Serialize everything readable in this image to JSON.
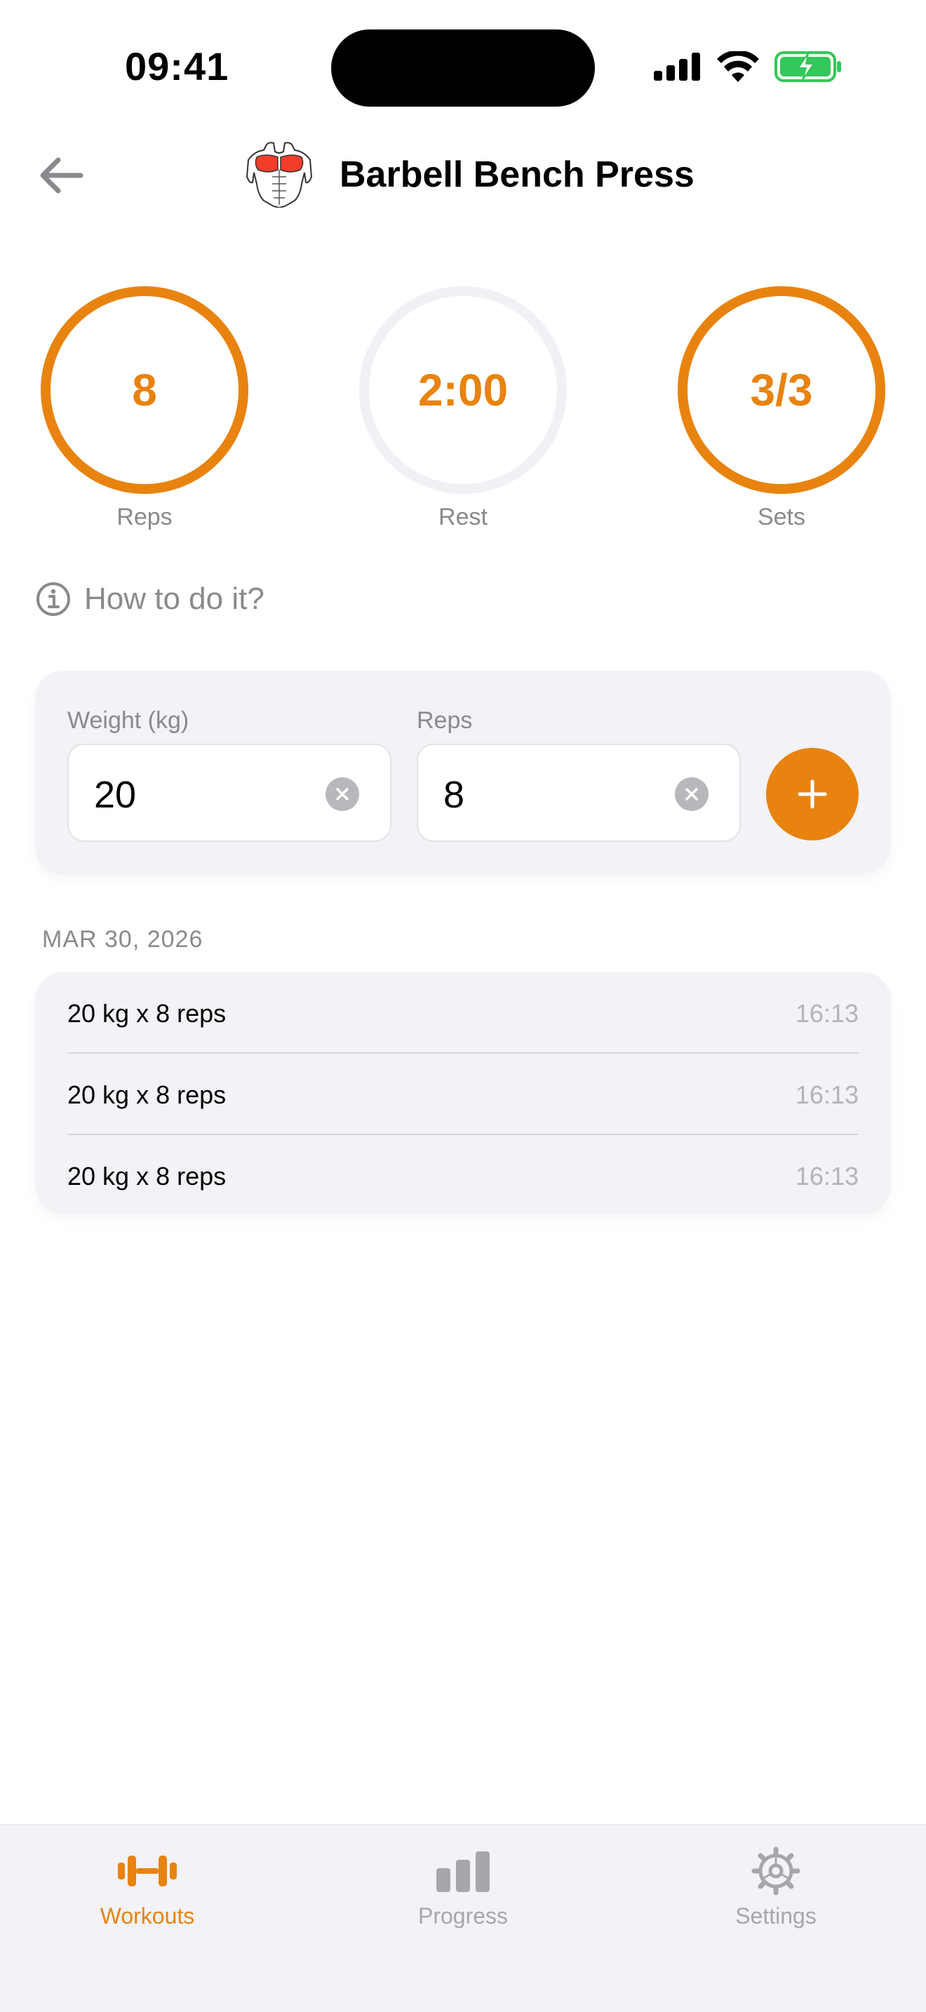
{
  "status_bar": {
    "time": "09:41"
  },
  "header": {
    "title": "Barbell Bench Press",
    "back_icon": "arrow-left-icon",
    "exercise_icon": "chest-muscle-icon"
  },
  "stats": [
    {
      "value": "8",
      "label": "Reps",
      "active": true
    },
    {
      "value": "2:00",
      "label": "Rest",
      "active": false
    },
    {
      "value": "3/3",
      "label": "Sets",
      "active": true
    }
  ],
  "how_to": {
    "label": "How to do it?",
    "icon": "info-icon"
  },
  "input": {
    "weight_label": "Weight (kg)",
    "weight_value": "20",
    "reps_label": "Reps",
    "reps_value": "8",
    "add_icon": "plus-icon"
  },
  "history": {
    "date": "MAR 30, 2026",
    "entries": [
      {
        "text": "20 kg x 8 reps",
        "time": "16:13"
      },
      {
        "text": "20 kg x 8 reps",
        "time": "16:13"
      },
      {
        "text": "20 kg x 8 reps",
        "time": "16:13"
      }
    ]
  },
  "tab_bar": {
    "tabs": [
      {
        "label": "Workouts",
        "icon": "dumbbell-icon",
        "active": true
      },
      {
        "label": "Progress",
        "icon": "bar-chart-icon",
        "active": false
      },
      {
        "label": "Settings",
        "icon": "gear-icon",
        "active": false
      }
    ]
  },
  "colors": {
    "accent": "#E8830F",
    "card_bg": "#F2F2F7",
    "muted_text": "#8A8A8E",
    "battery": "#34C759"
  }
}
